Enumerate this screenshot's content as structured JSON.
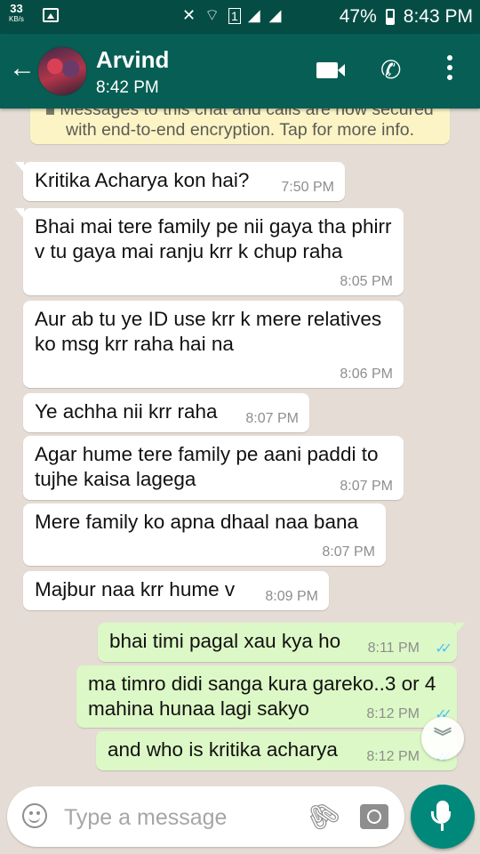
{
  "status_bar": {
    "net_speed_value": "33",
    "net_speed_unit": "KB/s",
    "battery": "47%",
    "time": "8:43 PM",
    "sim_badge": "1"
  },
  "header": {
    "contact_name": "Arvind",
    "status": "8:42 PM"
  },
  "encryption_notice": {
    "line1": "Messages to this chat and calls are now secured",
    "line2": "with end-to-end encryption. Tap for more info."
  },
  "messages": [
    {
      "direction": "in",
      "text": "Kritika Acharya kon hai?",
      "time": "7:50 PM"
    },
    {
      "direction": "in",
      "text": "Bhai mai tere family pe nii gaya tha phirr v tu gaya mai ranju krr k chup raha",
      "time": "8:05 PM"
    },
    {
      "direction": "in",
      "text": "Aur ab tu ye ID use krr k mere relatives ko msg krr raha hai na",
      "time": "8:06 PM"
    },
    {
      "direction": "in",
      "text": "Ye achha nii krr raha",
      "time": "8:07 PM"
    },
    {
      "direction": "in",
      "text": "Agar hume tere family pe aani paddi to tujhe kaisa lagega",
      "time": "8:07 PM"
    },
    {
      "direction": "in",
      "text": "Mere family ko apna dhaal naa bana",
      "time": "8:07 PM"
    },
    {
      "direction": "in",
      "text": "Majbur naa krr hume v",
      "time": "8:09 PM"
    },
    {
      "direction": "out",
      "text": "bhai timi pagal xau kya ho",
      "time": "8:11 PM",
      "read": true
    },
    {
      "direction": "out",
      "text": "ma timro didi sanga kura gareko..3 or 4 mahina hunaa lagi sakyo",
      "time": "8:12 PM",
      "read": true
    },
    {
      "direction": "out",
      "text": "and who is kritika acharya",
      "time": "8:12 PM",
      "read": true
    }
  ],
  "input": {
    "placeholder": "Type a message",
    "value": ""
  },
  "colors": {
    "header": "#075e54",
    "status_bar": "#054d44",
    "outgoing_bubble": "#dcf8c6",
    "incoming_bubble": "#ffffff",
    "read_ticks": "#4fc3f7",
    "send_button": "#00897b",
    "chat_background": "#e5ddd5"
  }
}
